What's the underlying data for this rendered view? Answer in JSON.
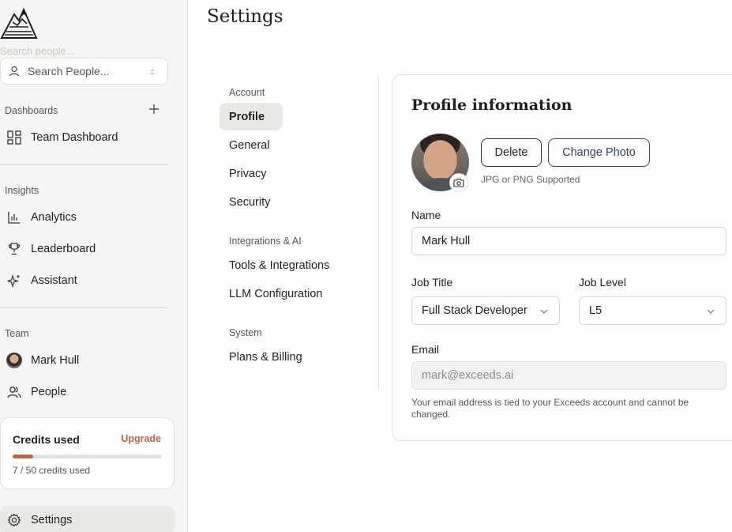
{
  "sidebar": {
    "ghost_search": "Search people...",
    "search_placeholder": "Search People...",
    "dashboards_label": "Dashboards",
    "dashboards": [
      {
        "label": "Team Dashboard"
      }
    ],
    "insights_label": "Insights",
    "insights": [
      {
        "label": "Analytics"
      },
      {
        "label": "Leaderboard"
      },
      {
        "label": "Assistant"
      }
    ],
    "team_label": "Team",
    "team": [
      {
        "label": "Mark Hull"
      },
      {
        "label": "People"
      }
    ],
    "credits": {
      "title": "Credits used",
      "upgrade": "Upgrade",
      "used": 7,
      "total": 50,
      "count_text": "7 / 50 credits used",
      "accent": "#b8674b"
    },
    "settings": {
      "label": "Settings"
    }
  },
  "page": {
    "title": "Settings"
  },
  "subnav": {
    "account_label": "Account",
    "account": [
      {
        "label": "Profile"
      },
      {
        "label": "General"
      },
      {
        "label": "Privacy"
      },
      {
        "label": "Security"
      }
    ],
    "integrations_label": "Integrations & AI",
    "integrations": [
      {
        "label": "Tools & Integrations"
      },
      {
        "label": "LLM Configuration"
      }
    ],
    "system_label": "System",
    "system": [
      {
        "label": "Plans & Billing"
      }
    ]
  },
  "profile": {
    "heading": "Profile information",
    "delete_label": "Delete",
    "change_photo_label": "Change Photo",
    "photo_hint": "JPG or PNG Supported",
    "name_label": "Name",
    "name_value": "Mark Hull",
    "job_title_label": "Job Title",
    "job_title_value": "Full Stack Developer",
    "job_level_label": "Job Level",
    "job_level_value": "L5",
    "email_label": "Email",
    "email_value": "mark@exceeds.ai",
    "email_note": "Your email address is tied to your Exceeds account and cannot be changed."
  }
}
